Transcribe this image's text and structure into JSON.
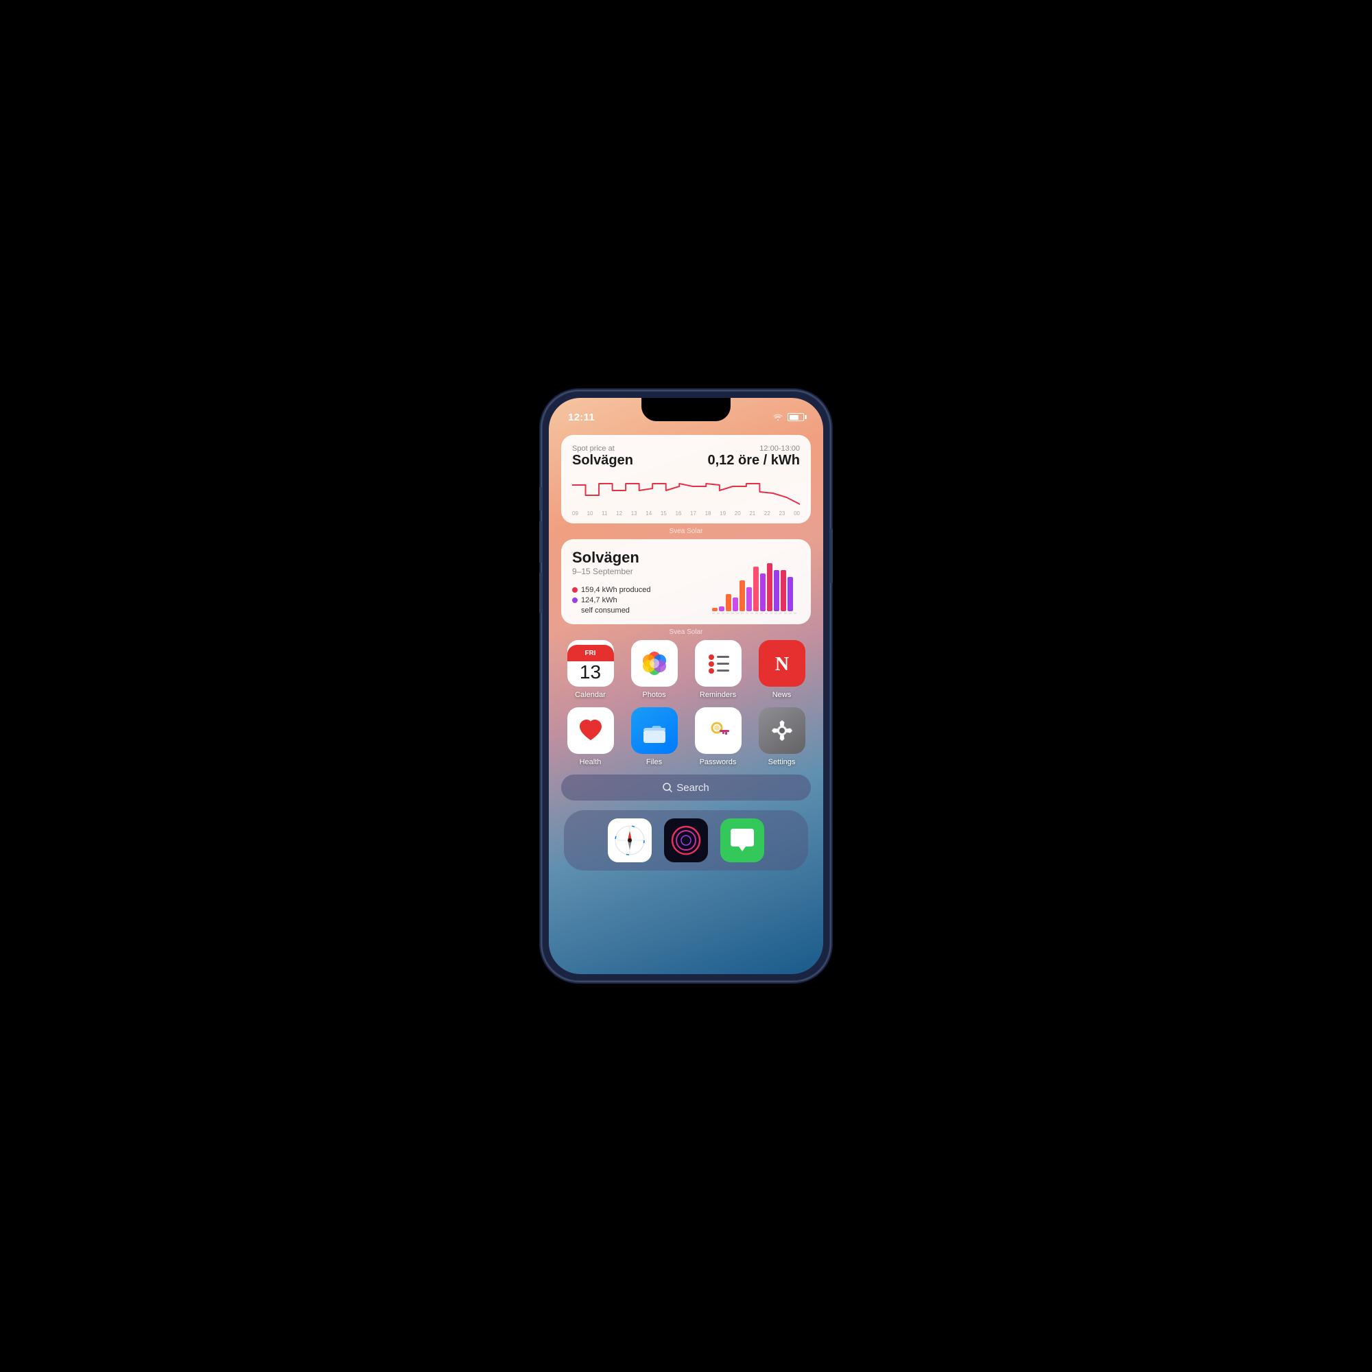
{
  "phone": {
    "status_bar": {
      "time": "12:11"
    },
    "widget_spot": {
      "label": "Spot price at",
      "title": "Solvägen",
      "time": "12:00-13:00",
      "price": "0,12 öre / kWh",
      "source": "Svea Solar",
      "x_labels": [
        "09",
        "10",
        "11",
        "12",
        "13",
        "14",
        "15",
        "16",
        "17",
        "18",
        "19",
        "20",
        "21",
        "22",
        "23",
        "00"
      ]
    },
    "widget_solar": {
      "title": "Solvägen",
      "date_range": "9–15 September",
      "legend": [
        {
          "color": "#e6304a",
          "text": "159,4 kWh produced"
        },
        {
          "color": "#9b3de8",
          "text": "124,7 kWh"
        },
        {
          "color": "#9b3de8",
          "text": "self consumed"
        }
      ],
      "source": "Svea Solar"
    },
    "apps_row1": [
      {
        "name": "Calendar",
        "id": "calendar",
        "day": "13",
        "day_label": "FRI"
      },
      {
        "name": "Photos",
        "id": "photos"
      },
      {
        "name": "Reminders",
        "id": "reminders"
      },
      {
        "name": "News",
        "id": "news"
      }
    ],
    "apps_row2": [
      {
        "name": "Health",
        "id": "health"
      },
      {
        "name": "Files",
        "id": "files"
      },
      {
        "name": "Passwords",
        "id": "passwords"
      },
      {
        "name": "Settings",
        "id": "settings"
      }
    ],
    "search": {
      "label": "Search"
    },
    "dock": [
      {
        "name": "Safari",
        "id": "safari"
      },
      {
        "name": "Focus",
        "id": "focus"
      },
      {
        "name": "Messages",
        "id": "messages"
      }
    ]
  }
}
